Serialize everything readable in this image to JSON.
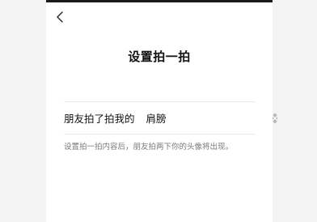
{
  "header": {
    "back_icon": "chevron-left-icon",
    "title": "设置拍一拍"
  },
  "form": {
    "prefix_label": "朋友拍了拍我的",
    "input_value": "肩膀",
    "clear_icon": "clear-circle-icon"
  },
  "hint": "设置拍一拍内容后，朋友拍两下你的头像将出现。",
  "colors": {
    "page_background": "#ffffff",
    "outer_background": "#f4f4f4",
    "text_primary": "#111111",
    "text_secondary": "#7a7a7a",
    "divider": "#e9e9e9",
    "clear_button": "#b9b9b9"
  }
}
